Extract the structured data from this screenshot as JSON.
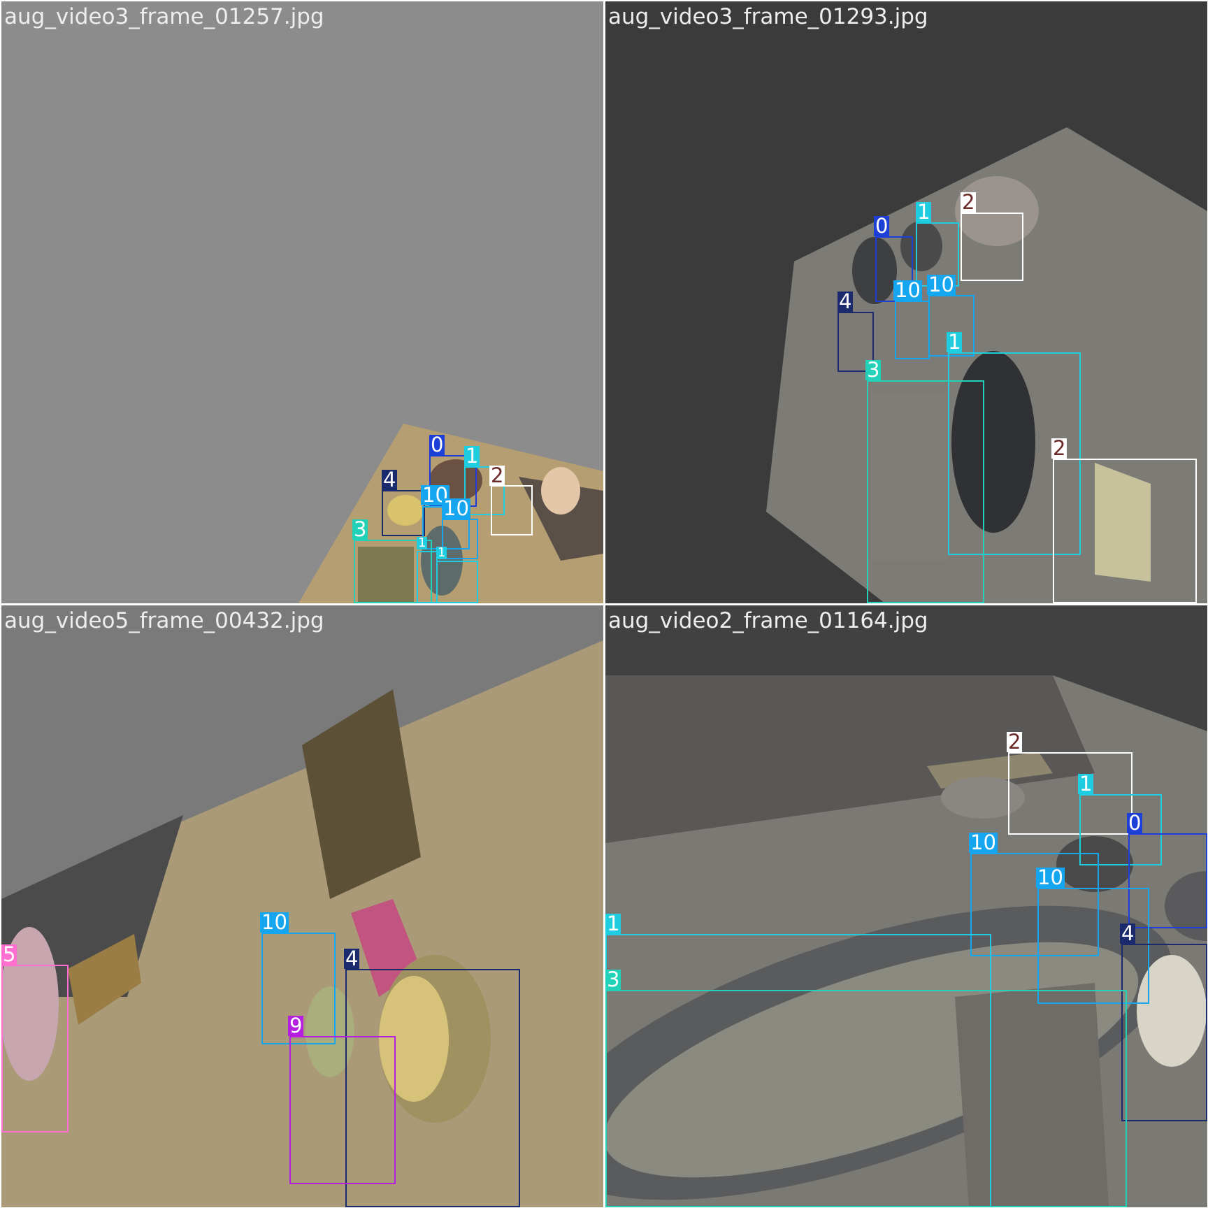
{
  "tiles": [
    {
      "filename": "aug_video3_frame_01257.jpg",
      "boxes": [
        {
          "label": "0"
        },
        {
          "label": "1"
        },
        {
          "label": "4"
        },
        {
          "label": "2"
        },
        {
          "label": "10"
        },
        {
          "label": "10"
        },
        {
          "label": "3"
        },
        {
          "label": "1"
        },
        {
          "label": "1"
        }
      ]
    },
    {
      "filename": "aug_video3_frame_01293.jpg",
      "boxes": [
        {
          "label": "0"
        },
        {
          "label": "1"
        },
        {
          "label": "2"
        },
        {
          "label": "10"
        },
        {
          "label": "10"
        },
        {
          "label": "4"
        },
        {
          "label": "1"
        },
        {
          "label": "3"
        },
        {
          "label": "2"
        }
      ]
    },
    {
      "filename": "aug_video5_frame_00432.jpg",
      "boxes": [
        {
          "label": "5"
        },
        {
          "label": "10"
        },
        {
          "label": "4"
        },
        {
          "label": "9"
        }
      ]
    },
    {
      "filename": "aug_video2_frame_01164.jpg",
      "boxes": [
        {
          "label": "2"
        },
        {
          "label": "1"
        },
        {
          "label": "0"
        },
        {
          "label": "10"
        },
        {
          "label": "10"
        },
        {
          "label": "4"
        },
        {
          "label": "1"
        },
        {
          "label": "3"
        }
      ]
    }
  ],
  "class_colors": {
    "0": "#1d3fd8",
    "1": "#1ecde0",
    "2": "#ffffff",
    "3": "#21d2b8",
    "4": "#1a2a6c",
    "5": "#ff6fd0",
    "9": "#b41fe0",
    "10": "#15a6ef"
  }
}
